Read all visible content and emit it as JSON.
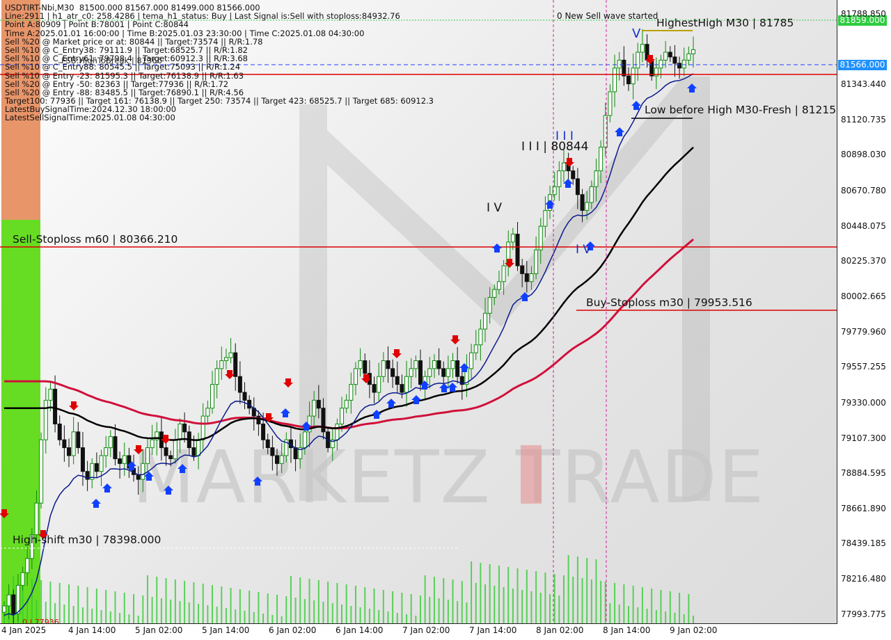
{
  "header": {
    "lines": [
      "USDTIRT-Nbi,M30  81500.000 81567.000 81499.000 81566.000",
      "Line:2911 | h1_atr_c0: 258.4286 | tema_h1_status: Buy | Last Signal is:Sell with stoploss:84932.76",
      "Point A:80909 | Point B:78001 | Point C:80844",
      "Time A:2025.01.01 16:00:00 | Time B:2025.01.03 23:30:00 | Time C:2025.01.08 04:30:00",
      "Sell %20 @ Market price or at: 80844 || Target:73574 || R/R:1.78",
      "Sell %10 @ C_Entry38: 79111.9 || Target:68525.7 || R/R:1.82",
      "Sell %10 @ C_Entry61: 79798.4 || Target:60912.3 || R/R:3.68",
      "Sell %10 @ C_Entry88: 80545.5 || Target:75093 || R/R:1.24",
      "Sell %10 @ Entry -23: 81595.3 || Target:76138.9 || R/R:1.63",
      "Sell %20 @ Entry -50: 82363 || Target:77936 || R/R:1.72",
      "Sell %20 @ Entry -88: 83485.5 || Target:76890.1 || R/R:4.56",
      "Target100: 77936 || Target 161: 76138.9 || Target 250: 73574 || Target 423: 68525.7 || Target 685: 60912.3",
      "LatestBuySignalTime:2024.12.30 18:00:00",
      "LatestSellSignalTime:2025.01.08 04:30:00"
    ],
    "overlap_text": "FSB:HighToBreak | 81366"
  },
  "labels": {
    "new_sell_wave": "0 New Sell wave started",
    "highest_high": "HighestHigh   M30 | 81785",
    "low_before_high": "Low before High   M30-Fresh | 81215.0",
    "wave_iii": "I I I | 80844",
    "wave_iv_upper": "I V",
    "wave_iii_top": "I I I",
    "wave_v": "V",
    "wave_iv_lower": "I V",
    "sell_stoploss": "Sell-Stoploss m60 | 80366.210",
    "buy_stoploss": "Buy-Stoploss m30 | 79953.516",
    "high_shift": "High-shift m30 | 78398.000",
    "bottom_left": "0 | 77936",
    "watermark": "MARKETZ TRADE"
  },
  "price_tags": {
    "top": "81859.000",
    "current": "81566.000"
  },
  "colors": {
    "sell_tag": "#2ecc40",
    "current_tag": "#1e90ff",
    "stoploss_line": "#dd0000",
    "ema_red": "#d0103a",
    "ema_black": "#000000",
    "ema_blue": "#0a1a8c",
    "bull_candle": "#0a8a0a",
    "bear_candle": "#111111",
    "volume": "#33cc33",
    "sell_arrow": "#e00000",
    "buy_arrow": "#1040ff"
  },
  "chart_data": {
    "type": "candlestick",
    "symbol": "USDTIRT-Nbi",
    "timeframe": "M30",
    "ohlc_last": {
      "open": 81500.0,
      "high": 81567.0,
      "low": 81499.0,
      "close": 81566.0
    },
    "y_ticks": [
      "81788.850",
      "81566.000",
      "81343.440",
      "81120.735",
      "80898.030",
      "80670.780",
      "80448.075",
      "80225.370",
      "80002.665",
      "79779.960",
      "79557.255",
      "79330.000",
      "79107.300",
      "78884.595",
      "78661.890",
      "78439.185",
      "78216.480",
      "77993.775"
    ],
    "x_ticks": [
      "4 Jan 2025",
      "4 Jan 14:00",
      "5 Jan 02:00",
      "5 Jan 14:00",
      "6 Jan 02:00",
      "6 Jan 14:00",
      "7 Jan 02:00",
      "7 Jan 14:00",
      "8 Jan 02:00",
      "8 Jan 14:00",
      "9 Jan 02:00"
    ],
    "ylim": [
      77940,
      81880
    ],
    "levels": [
      {
        "name": "Sell-Stoploss m60",
        "value": 80366.21
      },
      {
        "name": "Buy-Stoploss m30",
        "value": 79953.516
      },
      {
        "name": "High-shift m30",
        "value": 78398.0
      },
      {
        "name": "HighestHigh M30",
        "value": 81785
      },
      {
        "name": "Low before High M30-Fresh",
        "value": 81215.0
      },
      {
        "name": "Last close",
        "value": 81566.0
      },
      {
        "name": "Top level",
        "value": 81859.0
      }
    ],
    "closes": [
      78050,
      78120,
      78000,
      78180,
      78260,
      78350,
      78500,
      78700,
      79100,
      79350,
      79420,
      79200,
      79100,
      79050,
      79000,
      79150,
      79050,
      78900,
      78850,
      78950,
      78900,
      79000,
      79050,
      79120,
      78980,
      78950,
      79000,
      78920,
      78880,
      78850,
      78950,
      79050,
      79100,
      79150,
      79050,
      79000,
      78980,
      79100,
      79200,
      79150,
      79050,
      79000,
      79100,
      79250,
      79300,
      79450,
      79550,
      79600,
      79620,
      79650,
      79500,
      79400,
      79350,
      79300,
      79250,
      79200,
      79100,
      79050,
      79000,
      78950,
      79000,
      79100,
      79050,
      78980,
      79050,
      79150,
      79250,
      79350,
      79300,
      79150,
      79050,
      79100,
      79200,
      79300,
      79350,
      79450,
      79550,
      79600,
      79520,
      79450,
      79400,
      79500,
      79600,
      79550,
      79500,
      79450,
      79400,
      79500,
      79550,
      79600,
      79450,
      79500,
      79550,
      79600,
      79550,
      79500,
      79550,
      79600,
      79500,
      79450,
      79550,
      79650,
      79700,
      79800,
      79900,
      80000,
      80050,
      80100,
      80200,
      80350,
      80400,
      80200,
      80150,
      80100,
      80150,
      80300,
      80450,
      80550,
      80650,
      80700,
      80800,
      80850,
      80800,
      80750,
      80650,
      80550,
      80600,
      80700,
      80800,
      80950,
      81150,
      81300,
      81450,
      81500,
      81400,
      81350,
      81450,
      81550,
      81600,
      81500,
      81400,
      81450,
      81500,
      81550,
      81520,
      81480,
      81450,
      81500,
      81540,
      81566
    ]
  }
}
